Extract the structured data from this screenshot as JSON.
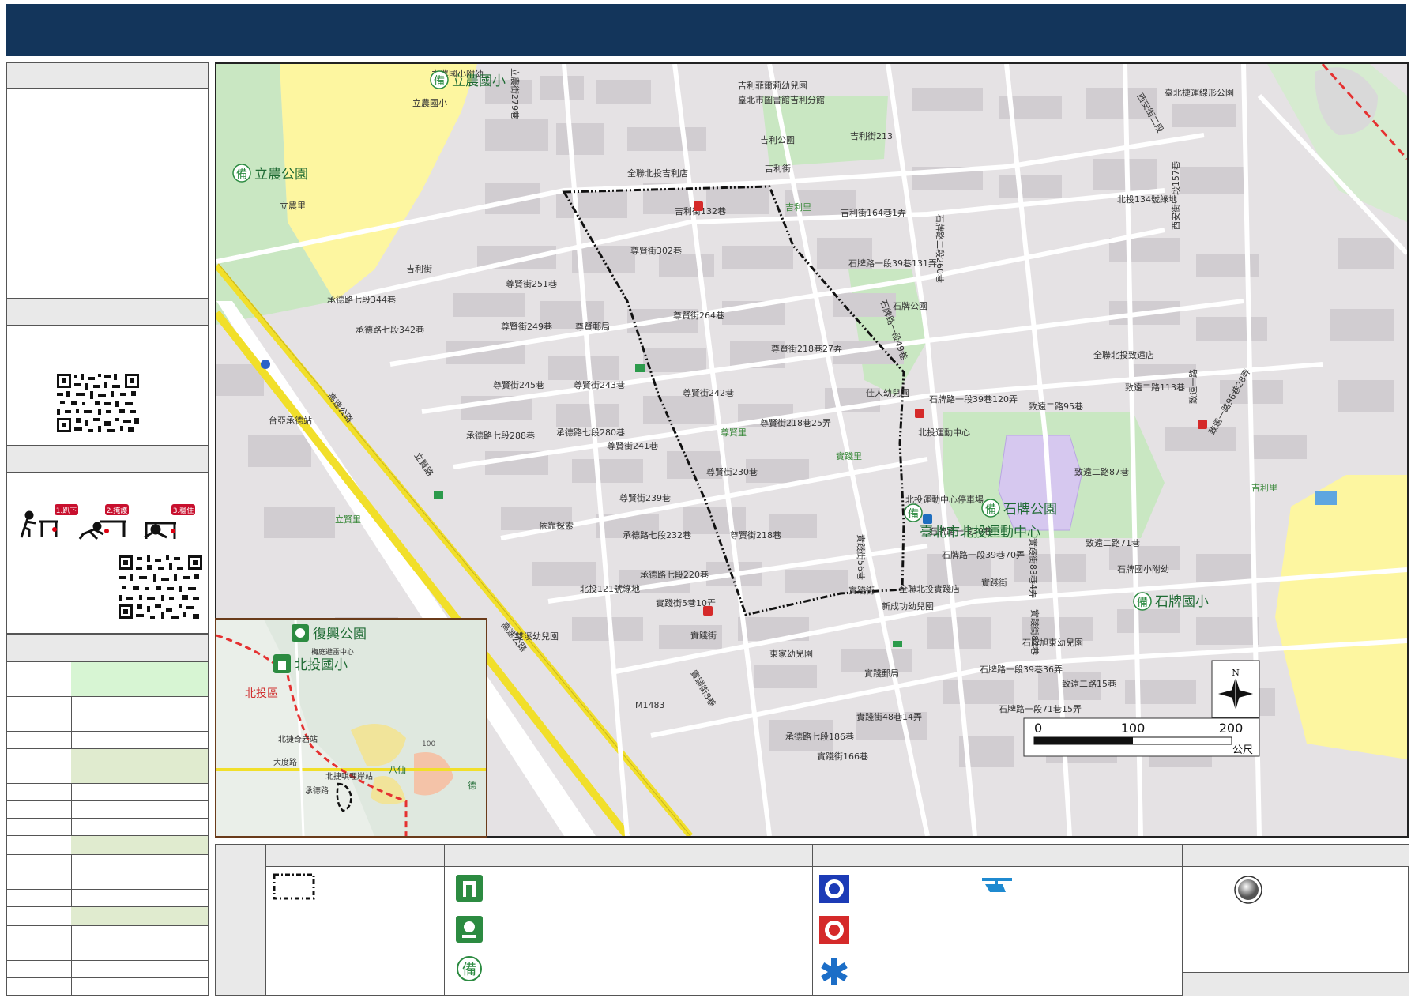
{
  "map": {
    "streets": {
      "lino_elem_annex": "立農國小附幼",
      "lino_elem": "立農國小",
      "lino_park": "立農公園",
      "lino_li": "立農里",
      "jili_st": "吉利街",
      "jili_132": "吉利街132巷",
      "jili_123": "吉利街123巷",
      "jili_213": "吉利街213",
      "jili_164_1": "吉利街164巷1弄",
      "jili_li": "吉利里",
      "jili_kinder": "吉利菲爾莉幼兒園",
      "jili_lib": "臺北市圖書館吉利分館",
      "jili_park": "吉利公園",
      "fmart_jili": "全聯北投吉利店",
      "zunxian_302": "尊賢街302巷",
      "zunxian_264": "尊賢街264巷",
      "zunxian_251": "尊賢街251巷",
      "zunxian_249": "尊賢街249巷",
      "zunxian_245": "尊賢街245巷",
      "zunxian_243": "尊賢街243巷",
      "zunxian_242": "尊賢街242巷",
      "zunxian_241": "尊賢街241巷",
      "zunxian_239": "尊賢街239巷",
      "zunxian_230": "尊賢街230巷",
      "zunxian_218": "尊賢街218巷",
      "zunxian_218_27": "尊賢街218巷27弄",
      "zunxian_218_25": "尊賢街218巷25弄",
      "zunxian_li": "尊賢里",
      "zunxian_post": "尊賢郵局",
      "chengde_344": "承德路七段344巷",
      "chengde_342": "承德路七段342巷",
      "chengde_288": "承德路七段288巷",
      "chengde_280": "承德路七段280巷",
      "chengde_232": "承德路七段232巷",
      "chengde_220": "承德路七段220巷",
      "chengde_186": "承德路七段186巷",
      "shipai_39_131": "石牌路一段39巷131弄",
      "shipai_39_120": "石牌路一段39巷120弄",
      "shipai_39_70": "石牌路一段39巷70弄",
      "shipai_39_36": "石牌路一段39巷36弄",
      "shipai_39_28": "石牌路一段39巷",
      "shipai_71_15": "石牌路一段71巷15弄",
      "shipai_park": "石牌公園",
      "shipai_park_big": "石牌公園",
      "shipai_elem": "石牌國小",
      "shipai_elem_annex": "石牌國小附幼",
      "sports_center": "臺北市北投運動中心",
      "sports_center_small": "北投運動中心",
      "sports_parking": "北投運動中心停車場",
      "zhiyuan_1": "致遠一路",
      "zhiyuan_2_95": "致遠二路95巷",
      "zhiyuan_2_87": "致遠二路87巷",
      "zhiyuan_2_113": "致遠二路113巷",
      "zhiyuan_2_15": "致遠二路15巷",
      "zhiyuan_2_71": "致遠二路71巷",
      "zhiyuan_fmart": "全聯北投致遠店",
      "shijian_st": "實踐街",
      "shijian_48_14": "實踐街48巷14弄",
      "shijian_post": "實踐郵局",
      "shijian_56": "實踐街56巷",
      "shijian_li": "實踐里",
      "shijian_5_10": "實踐街5巷10弄",
      "xinchen_kinder": "新成功幼兒園",
      "dongjia_kinder": "東家幼兒園",
      "jiapei_kinder": "佳人幼兒園",
      "shuangxi_kinder": "雙溪幼兒園",
      "xingxiang": "依靠探索",
      "beitou_121": "北投121號綠地",
      "beitou_134": "北投134號綠地",
      "lixian_li": "立賢里",
      "lixian_rd": "立賢路",
      "taiya": "台亞承德站",
      "highway": "高速公路",
      "chengde_rd_big": "承德路七段",
      "xian_an": "西安街二段",
      "xian_an_157": "西安街一段157巷",
      "mrt_park": "臺北捷運線形公園",
      "zhiyuan_nandi": "致遠二路",
      "sign_279": "立農街279巷",
      "sign_49": "石牌路一段49巷",
      "sign_260": "石牌路二段260巷",
      "sign_83_4": "實踐街83巷4弄",
      "sign_82": "實踐街82巷",
      "sign_96_28": "致遠一路96巷28弄",
      "zhiyuan_71": "致遠二路71巷",
      "shijian_8": "實踐街8巷",
      "shijian_166": "實踐街166巷",
      "m1483": "M1483",
      "fmart_shijian": "全聯北投實踐店",
      "jiayi_li": "吉利里",
      "ring_label": "石牌旭東幼兒園"
    },
    "evac_icon_label": "備"
  },
  "scale": {
    "ticks": [
      "0",
      "100",
      "200"
    ],
    "unit": "公尺",
    "north": "N"
  },
  "inset": {
    "fuxing_park": "復興公園",
    "beitou_elem": "北投國小",
    "meiting": "梅庭避雷中心",
    "beitou_dist": "北投區",
    "qiyan_stn": "北捷奇岩站",
    "datun_rd": "大度路",
    "chengde_rd": "承德路",
    "shipai_stn": "北捷唭哩岸站",
    "bafen": "八仙",
    "zhenli": "德",
    "elev": "100"
  },
  "drill": {
    "step1": "1.趴下",
    "step2": "2.掩護",
    "step3": "3.穩住"
  }
}
